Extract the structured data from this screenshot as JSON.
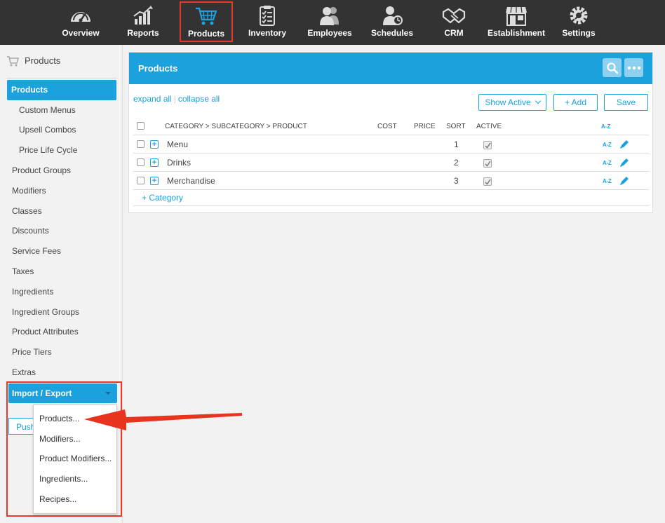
{
  "topnav": {
    "items": [
      {
        "label": "Overview",
        "icon": "gauge-icon"
      },
      {
        "label": "Reports",
        "icon": "chart-icon"
      },
      {
        "label": "Products",
        "icon": "cart-icon",
        "active": true
      },
      {
        "label": "Inventory",
        "icon": "clipboard-icon"
      },
      {
        "label": "Employees",
        "icon": "people-icon"
      },
      {
        "label": "Schedules",
        "icon": "person-clock-icon"
      },
      {
        "label": "CRM",
        "icon": "handshake-icon"
      },
      {
        "label": "Establishment",
        "icon": "storefront-icon"
      },
      {
        "label": "Settings",
        "icon": "gear-icon"
      }
    ],
    "active_color": "#1ba1dc"
  },
  "sidebar": {
    "title": "Products",
    "active_item": "Products",
    "sub_items": [
      "Custom Menus",
      "Upsell Combos",
      "Price Life Cycle"
    ],
    "items": [
      "Product Groups",
      "Modifiers",
      "Classes",
      "Discounts",
      "Service Fees",
      "Taxes",
      "Ingredients",
      "Ingredient Groups",
      "Product Attributes",
      "Price Tiers",
      "Extras"
    ],
    "import_export": {
      "label": "Import / Export",
      "push_label": "Push",
      "options": [
        "Products...",
        "Modifiers...",
        "Product Modifiers...",
        "Ingredients...",
        "Recipes..."
      ]
    }
  },
  "panel": {
    "title": "Products",
    "expand_all": "expand all",
    "separator": "|",
    "collapse_all": "collapse all",
    "filter_select": "Show Active",
    "add_button": "+ Add",
    "save_button": "Save",
    "columns": {
      "path": "CATEGORY > SUBCATEGORY > PRODUCT",
      "cost": "COST",
      "price": "PRICE",
      "sort": "SORT",
      "active": "ACTIVE",
      "az": "A-Z"
    },
    "rows": [
      {
        "name": "Menu",
        "sort": "1",
        "active": true
      },
      {
        "name": "Drinks",
        "sort": "2",
        "active": true
      },
      {
        "name": "Merchandise",
        "sort": "3",
        "active": true
      }
    ],
    "add_category": "+ Category"
  },
  "colors": {
    "accent": "#1ba1dc",
    "highlight": "#e43b2a",
    "nav_bg": "#333333"
  }
}
